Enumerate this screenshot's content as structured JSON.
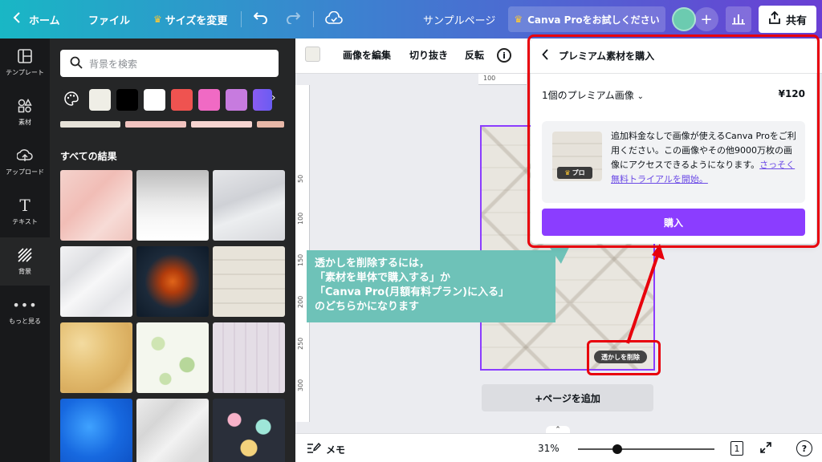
{
  "topbar": {
    "home": "ホーム",
    "file": "ファイル",
    "resize": "サイズを変更",
    "doc_title": "サンプルページ",
    "try_pro": "Canva Proをお試しください",
    "share": "共有"
  },
  "rail": {
    "items": [
      {
        "label": "テンプレート",
        "icon": "template-icon"
      },
      {
        "label": "素材",
        "icon": "elements-icon"
      },
      {
        "label": "アップロード",
        "icon": "upload-icon"
      },
      {
        "label": "テキスト",
        "icon": "text-icon"
      },
      {
        "label": "背景",
        "icon": "background-icon"
      },
      {
        "label": "もっと見る",
        "icon": "more-icon"
      }
    ]
  },
  "panel": {
    "search_placeholder": "背景を検索",
    "swatch_colors": [
      "#efeee6",
      "#000000",
      "#ffffff",
      "#ef5350",
      "#f06ac4",
      "#c77bdf",
      "#8a5cf2"
    ],
    "results_heading": "すべての結果"
  },
  "canvas_toolbar": {
    "edit_image": "画像を編集",
    "crop": "切り抜き",
    "flip": "反転"
  },
  "rulers": {
    "top": [
      "100"
    ],
    "left": [
      "50",
      "100",
      "150",
      "200",
      "250",
      "300"
    ]
  },
  "page": {
    "remove_watermark": "透かしを削除",
    "add_page": "+ページを追加"
  },
  "callout": {
    "lines": [
      "透かしを削除するには，",
      "「素材を単体で購入する」か",
      "「Canva Pro(月額有料プラン)に入る」",
      "のどちらかになります"
    ]
  },
  "popup": {
    "title": "プレミアム素材を購入",
    "item_label": "1個のプレミアム画像",
    "price": "¥120",
    "description": "追加料金なしで画像が使えるCanva Proをご利用ください。この画像やその他9000万枚の画像にアクセスできるようになります。",
    "link": "さっそく無料トライアルを開始。",
    "pro_badge": "プロ",
    "buy": "購入"
  },
  "bottombar": {
    "memo": "メモ",
    "zoom": "31%",
    "zoom_value": 0.29,
    "page_count": "1"
  },
  "colors": {
    "accent_purple": "#8b3dff",
    "highlight_red": "#e8000c",
    "callout_teal": "#6ec2b8"
  }
}
